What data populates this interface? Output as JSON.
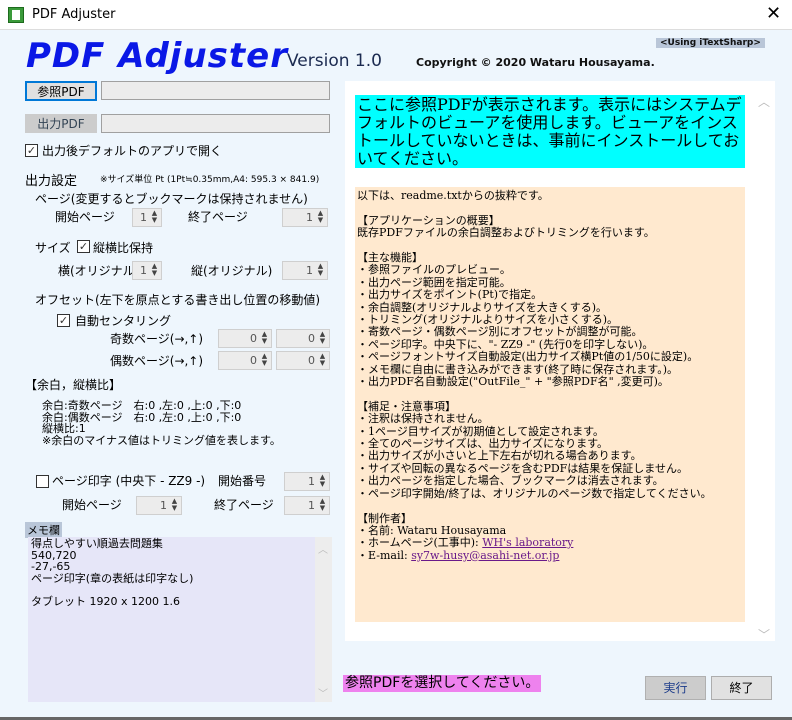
{
  "window": {
    "title": "PDF Adjuster",
    "close": "✕"
  },
  "header": {
    "logo": "PDF Adjuster",
    "version": "Version 1.0",
    "copyright": "Copyright ©  2020  Wataru Housayama.",
    "library": "<Using iTextSharp>"
  },
  "files": {
    "ref_button": "参照PDF",
    "ref_value": "",
    "out_button": "出力PDF",
    "out_value": "",
    "open_after_label": "出力後デフォルトのアプリで開く",
    "open_after_checked": true
  },
  "settings": {
    "title": "出力設定",
    "unit_note": "※サイズ単位 Pt (1Pt≒0.35mm,A4: 595.3 × 841.9)",
    "page_heading": "ページ(変更するとブックマークは保持されません)",
    "start_label": "開始ページ",
    "start_value": "1",
    "end_label": "終了ページ",
    "end_value": "1",
    "size_label": "サイズ",
    "keep_ratio_label": "縦横比保持",
    "keep_ratio_checked": true,
    "width_label": "横(オリジナル)",
    "width_value": "1",
    "height_label": "縦(オリジナル)",
    "height_value": "1",
    "offset_heading": "オフセット(左下を原点とする書き出し位置の移動値)",
    "auto_center_label": "自動センタリング",
    "auto_center_checked": true,
    "odd_label": "奇数ページ(→,↑)",
    "odd_x": "0",
    "odd_y": "0",
    "even_label": "偶数ページ(→,↑)",
    "even_x": "0",
    "even_y": "0"
  },
  "margins": {
    "heading": "【余白，縦横比】",
    "lines": [
      "余白:奇数ページ　右:0 ,左:0 ,上:0 ,下:0",
      "余白:偶数ページ　右:0 ,左:0 ,上:0 ,下:0",
      "縦横比:1",
      "※余白のマイナス値はトリミング値を表します。"
    ]
  },
  "page_print": {
    "label": "ページ印字 (中央下 - ZZ9 -)",
    "checked": false,
    "start_no_label": "開始番号",
    "start_no": "1",
    "start_page_label": "開始ページ",
    "start_page": "1",
    "end_page_label": "終了ページ",
    "end_page": "1"
  },
  "memo": {
    "label": "メモ欄",
    "lines": [
      "得点しやすい順過去問題集",
      "540,720",
      "-27,-65",
      "ページ印字(章の表紙は印字なし)",
      "",
      "タブレット 1920 x 1200 1.6"
    ]
  },
  "preview": {
    "notice": "ここに参照PDFが表示されます。表示にはシステムデフォルトのビューアを使用します。ビューアをインストールしていないときは、事前にインストールしておいてください。",
    "readme": [
      "以下は、readme.txtからの抜粋です。",
      "",
      "【アプリケーションの概要】",
      "既存PDFファイルの余白調整およびトリミングを行います。",
      "",
      "【主な機能】",
      "・参照ファイルのプレビュー。",
      "・出力ページ範囲を指定可能。",
      "・出力サイズをポイント(Pt)で指定。",
      "・余白調整(オリジナルよりサイズを大きくする)。",
      "・トリミング(オリジナルよりサイズを小さくする)。",
      "・寄数ページ・偶数ページ別にオフセットが調整が可能。",
      "・ページ印字。中央下に、\"- ZZ9 -\" (先行0を印字しない)。",
      "・ページフォントサイズ自動設定(出力サイズ横Pt値の1/50に設定)。",
      "・メモ欄に自由に書き込みができます(終了時に保存されます。)。",
      "・出力PDF名自動設定(\"OutFile_\" + \"参照PDF名\" ,変更可)。",
      "",
      "【補足・注意事項】",
      "・注釈は保持されません。",
      "・1ページ目サイズが初期値として設定されます。",
      "・全てのページサイズは、出力サイズになります。",
      "・出力サイズが小さいと上下左右が切れる場合あります。",
      "・サイズや回転の異なるページを含むPDFは結果を保証しません。",
      "・出力ページを指定した場合、ブックマークは消去されます。",
      "・ページ印字開始/終了は、オリジナルのページ数で指定してください。",
      "",
      "【制作者】",
      "・名前: Wataru Housayama"
    ],
    "homepage_label": "・ホームページ(工事中): ",
    "homepage_link": "WH's laboratory",
    "email_label": "・E-mail: ",
    "email_link": "sy7w-husy@asahi-net.or.jp"
  },
  "status": "参照PDFを選択してください。",
  "actions": {
    "run": "実行",
    "exit": "終了"
  },
  "colors": {
    "logo": "#0a18e6",
    "notice_bg": "#00ffff",
    "readme_bg": "#ffe9cf",
    "status_bg": "#ee82ee",
    "memo_bg": "#e6e6f8"
  }
}
